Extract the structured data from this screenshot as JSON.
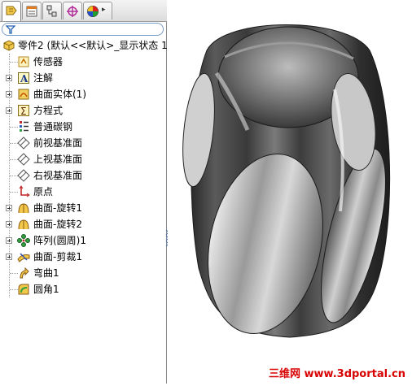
{
  "tabs": [
    {
      "icon": "feature-manager-icon",
      "active": true
    },
    {
      "icon": "property-manager-icon",
      "active": false
    },
    {
      "icon": "configuration-manager-icon",
      "active": false
    },
    {
      "icon": "dimxpert-icon",
      "active": false
    },
    {
      "icon": "display-manager-icon",
      "active": false
    }
  ],
  "filter": {
    "icon": "filter-icon"
  },
  "tree": {
    "root": {
      "label": "零件2  (默认<<默认>_显示状态 1",
      "icon": "part-icon"
    },
    "items": [
      {
        "label": "传感器",
        "icon": "sensor-icon",
        "expandable": false
      },
      {
        "label": "注解",
        "icon": "annotation-icon",
        "expandable": true
      },
      {
        "label": "曲面实体(1)",
        "icon": "surface-bodies-icon",
        "expandable": true
      },
      {
        "label": "方程式",
        "icon": "equations-icon",
        "expandable": true
      },
      {
        "label": "普通碳钢",
        "icon": "material-icon",
        "expandable": false
      },
      {
        "label": "前视基准面",
        "icon": "plane-icon",
        "expandable": false
      },
      {
        "label": "上视基准面",
        "icon": "plane-icon",
        "expandable": false
      },
      {
        "label": "右视基准面",
        "icon": "plane-icon",
        "expandable": false
      },
      {
        "label": "原点",
        "icon": "origin-icon",
        "expandable": false
      },
      {
        "label": "曲面-旋转1",
        "icon": "surface-revolve-icon",
        "expandable": true
      },
      {
        "label": "曲面-旋转2",
        "icon": "surface-revolve-icon",
        "expandable": true
      },
      {
        "label": "阵列(圆周)1",
        "icon": "circular-pattern-icon",
        "expandable": true
      },
      {
        "label": "曲面-剪裁1",
        "icon": "surface-trim-icon",
        "expandable": true
      },
      {
        "label": "弯曲1",
        "icon": "flex-icon",
        "expandable": false
      },
      {
        "label": "圆角1",
        "icon": "fillet-icon",
        "expandable": false
      }
    ]
  },
  "watermark": "三维网 www.3dportal.cn",
  "colors": {
    "watermark": "#d80000",
    "selection_border": "#7a9cc8",
    "model_metal": "#4a4a4a"
  }
}
